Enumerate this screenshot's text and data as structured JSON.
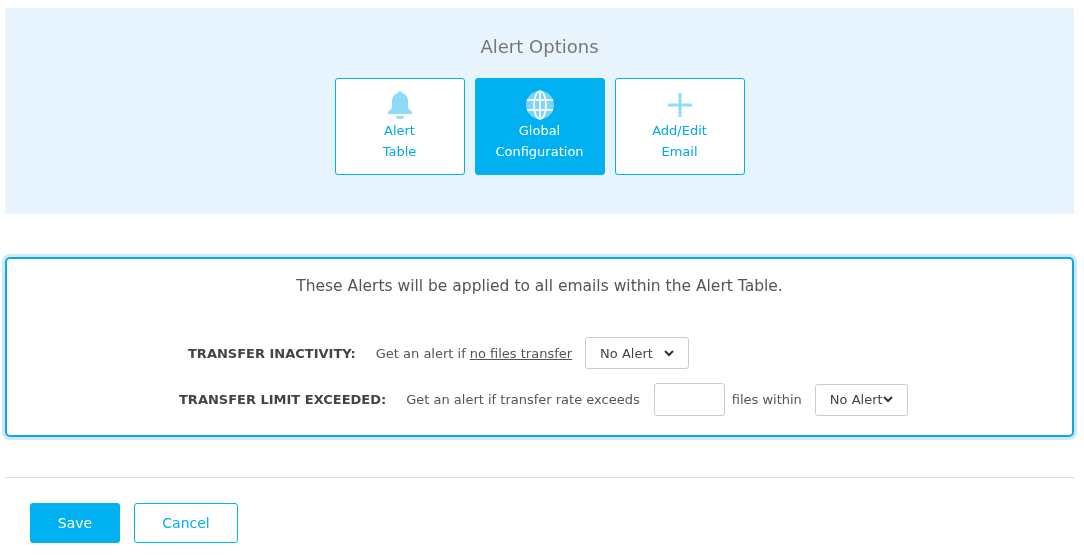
{
  "header": {
    "title": "Alert Options"
  },
  "options": [
    {
      "kind": "bell",
      "label_lines": [
        "Alert",
        "Table"
      ],
      "selected": false
    },
    {
      "kind": "globe",
      "label_lines": [
        "Global",
        "Configuration"
      ],
      "selected": true
    },
    {
      "kind": "plus",
      "label_lines": [
        "Add/Edit",
        "Email"
      ],
      "selected": false
    }
  ],
  "panel": {
    "intro": "These Alerts will be applied to all emails within the Alert Table.",
    "rows": [
      {
        "kind": "inactivity",
        "label": "TRANSFER INACTIVITY:",
        "text": "Get an alert if",
        "link": "no files transfer",
        "select": "No Alert"
      },
      {
        "kind": "limit",
        "label": "TRANSFER LIMIT EXCEEDED:",
        "text": "Get an alert if transfer rate exceeds",
        "after_input": "files within",
        "select": "No Alert"
      }
    ]
  },
  "buttons": {
    "save": "Save",
    "cancel": "Cancel"
  }
}
